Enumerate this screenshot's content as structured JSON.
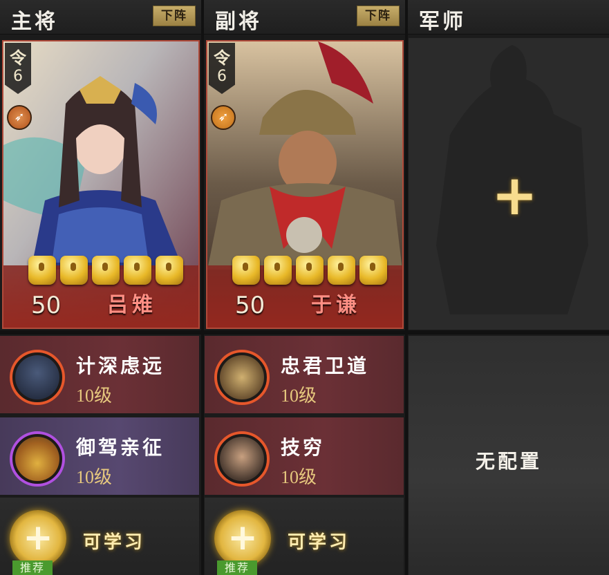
{
  "columns": {
    "main": {
      "title": "主将",
      "button": "下阵"
    },
    "vice": {
      "title": "副将",
      "button": "下阵"
    },
    "advisor": {
      "title": "军师",
      "empty_text": "无配置"
    }
  },
  "cards": {
    "main": {
      "order_char": "令",
      "order_count": "6",
      "level": "50",
      "name": "吕雉",
      "stars": 5
    },
    "vice": {
      "order_char": "令",
      "order_count": "6",
      "level": "50",
      "name": "于谦",
      "stars": 5
    }
  },
  "skills": {
    "main": [
      {
        "name": "计深虑远",
        "level": "10级",
        "quality": "red"
      },
      {
        "name": "御驾亲征",
        "level": "10级",
        "quality": "purple"
      }
    ],
    "vice": [
      {
        "name": "忠君卫道",
        "level": "10级",
        "quality": "red"
      },
      {
        "name": "技穷",
        "level": "10级",
        "quality": "red"
      }
    ]
  },
  "learnable": {
    "label": "可学习",
    "badge": "推荐"
  },
  "icons": {
    "weapon": "spear-icon",
    "star": "star-token-icon",
    "add": "plus-icon"
  },
  "colors": {
    "card_border": "#b04a3a",
    "name_text": "#ff8f84",
    "skill_level": "#e6c87e",
    "recommend_badge": "#4a9a2e"
  }
}
